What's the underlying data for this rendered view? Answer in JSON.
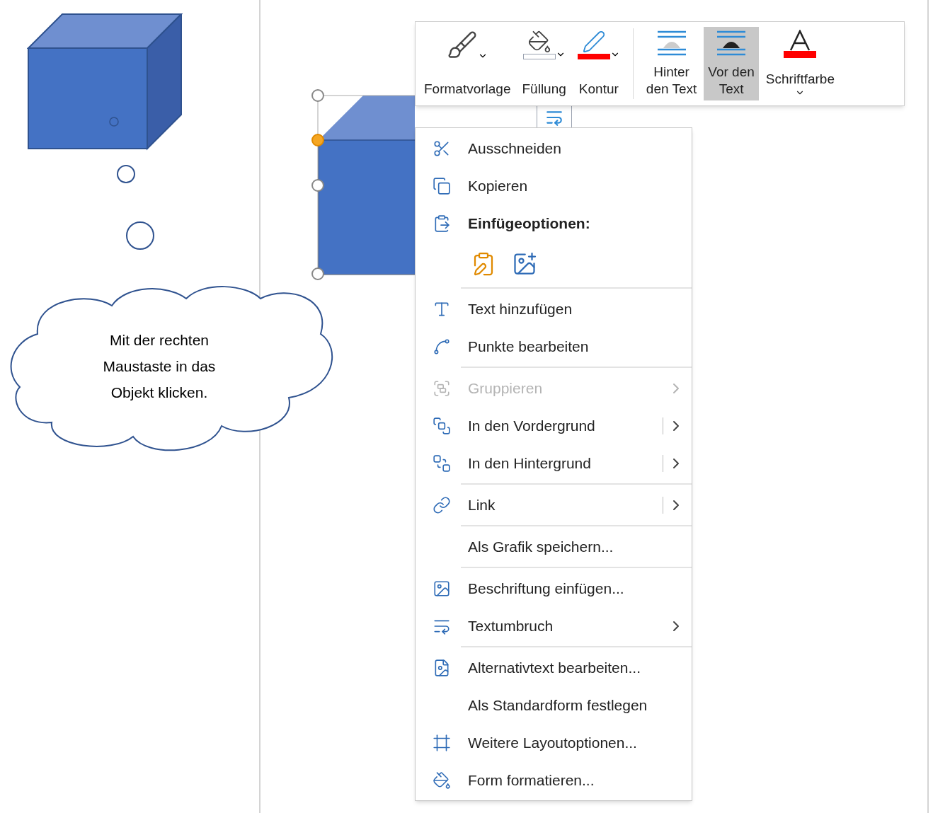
{
  "callout": {
    "text": "Mit der rechten Maustaste in das Objekt klicken."
  },
  "toolbar": {
    "buttons": [
      {
        "kind": "style",
        "lines": [
          "Formatvorlage"
        ],
        "selected": false,
        "caret": true
      },
      {
        "kind": "fill",
        "lines": [
          "Füllung"
        ],
        "selected": false,
        "caret": true,
        "color": "#ffffff"
      },
      {
        "kind": "outline",
        "lines": [
          "Kontur"
        ],
        "selected": false,
        "caret": true,
        "color": "#ff0000"
      },
      {
        "kind": "behind",
        "lines": [
          "Hinter",
          "den Text"
        ],
        "selected": false,
        "caret": false
      },
      {
        "kind": "front",
        "lines": [
          "Vor den",
          "Text"
        ],
        "selected": true,
        "caret": false
      },
      {
        "kind": "fontcolor",
        "lines": [
          "Schriftfarbe"
        ],
        "selected": false,
        "caret": true,
        "color": "#ff0000"
      }
    ]
  },
  "menu": {
    "groups": [
      [
        {
          "kind": "command",
          "label": "Ausschneiden",
          "disabled": false,
          "submenu": false,
          "split": false
        },
        {
          "kind": "command",
          "label": "Kopieren",
          "disabled": false,
          "submenu": false,
          "split": false
        },
        {
          "kind": "header",
          "label": "Einfügeoptionen:",
          "disabled": false,
          "submenu": false,
          "split": false
        },
        {
          "kind": "paste-options"
        }
      ],
      [
        {
          "kind": "command",
          "label": "Text hinzufügen",
          "disabled": false,
          "submenu": false,
          "split": false
        },
        {
          "kind": "command",
          "label": "Punkte bearbeiten",
          "disabled": false,
          "submenu": false,
          "split": false
        }
      ],
      [
        {
          "kind": "command",
          "label": "Gruppieren",
          "disabled": true,
          "submenu": true,
          "split": false
        },
        {
          "kind": "command",
          "label": "In den Vordergrund",
          "disabled": false,
          "submenu": true,
          "split": true
        },
        {
          "kind": "command",
          "label": "In den Hintergrund",
          "disabled": false,
          "submenu": true,
          "split": true
        }
      ],
      [
        {
          "kind": "command",
          "label": "Link",
          "disabled": false,
          "submenu": true,
          "split": true
        }
      ],
      [
        {
          "kind": "command",
          "label": "Als Grafik speichern...",
          "disabled": false,
          "submenu": false,
          "split": false
        }
      ],
      [
        {
          "kind": "command",
          "label": "Beschriftung einfügen...",
          "disabled": false,
          "submenu": false,
          "split": false
        },
        {
          "kind": "command",
          "label": "Textumbruch",
          "disabled": false,
          "submenu": true,
          "split": false
        }
      ],
      [
        {
          "kind": "command",
          "label": "Alternativtext bearbeiten...",
          "disabled": false,
          "submenu": false,
          "split": false
        },
        {
          "kind": "command",
          "label": "Als Standardform festlegen",
          "disabled": false,
          "submenu": false,
          "split": false
        },
        {
          "kind": "command",
          "label": "Weitere Layoutoptionen...",
          "disabled": false,
          "submenu": false,
          "split": false
        },
        {
          "kind": "command",
          "label": "Form formatieren...",
          "disabled": false,
          "submenu": false,
          "split": false
        }
      ]
    ]
  }
}
